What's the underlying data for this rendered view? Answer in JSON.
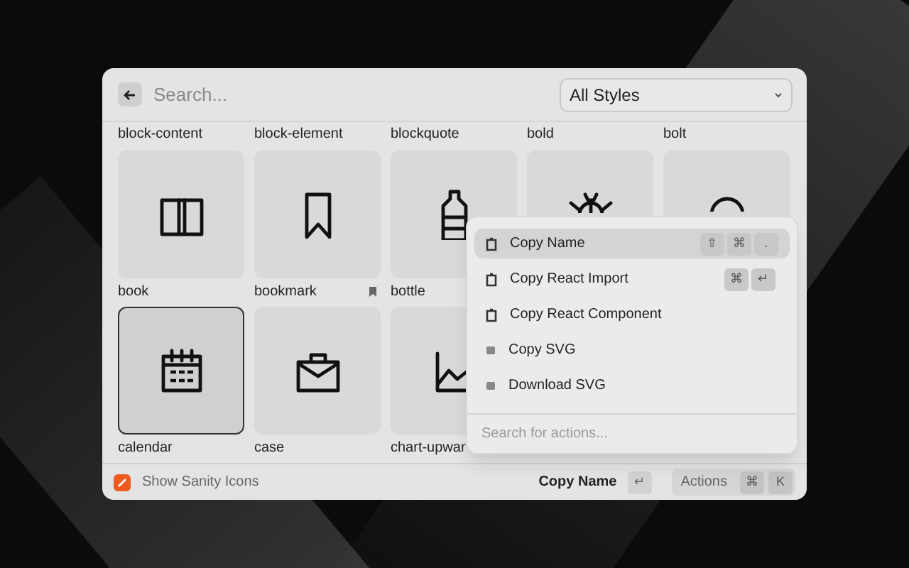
{
  "search": {
    "placeholder": "Search..."
  },
  "style_select": {
    "value": "All Styles"
  },
  "grid": {
    "label_row": [
      "block-content",
      "block-element",
      "blockquote",
      "bold",
      "bolt"
    ],
    "items": [
      {
        "label": "book",
        "bookmarked": false,
        "selected": false
      },
      {
        "label": "bookmark",
        "bookmarked": true,
        "selected": false
      },
      {
        "label": "bottle",
        "bookmarked": false,
        "selected": false
      },
      {
        "selected": false
      },
      {
        "selected": false
      },
      {
        "label": "calendar",
        "bookmarked": false,
        "selected": true
      },
      {
        "label": "case",
        "bookmarked": false,
        "selected": false
      },
      {
        "label": "chart-upwar",
        "bookmarked": false,
        "selected": false
      }
    ]
  },
  "actions_menu": {
    "items": [
      {
        "label": "Copy Name",
        "kind": "clipboard",
        "selected": true,
        "keys": [
          "⇧",
          "⌘",
          "."
        ]
      },
      {
        "label": "Copy React Import",
        "kind": "clipboard",
        "selected": false,
        "keys": [
          "⌘",
          "↵"
        ]
      },
      {
        "label": "Copy React Component",
        "kind": "clipboard",
        "selected": false
      },
      {
        "label": "Copy SVG",
        "kind": "file",
        "selected": false
      },
      {
        "label": "Download SVG",
        "kind": "file",
        "selected": false
      }
    ],
    "search_placeholder": "Search for actions..."
  },
  "footer": {
    "toggle_label": "Show Sanity Icons",
    "primary_action": "Copy Name",
    "primary_keys": [
      "↵"
    ],
    "actions_label": "Actions",
    "actions_keys": [
      "⌘",
      "K"
    ]
  }
}
